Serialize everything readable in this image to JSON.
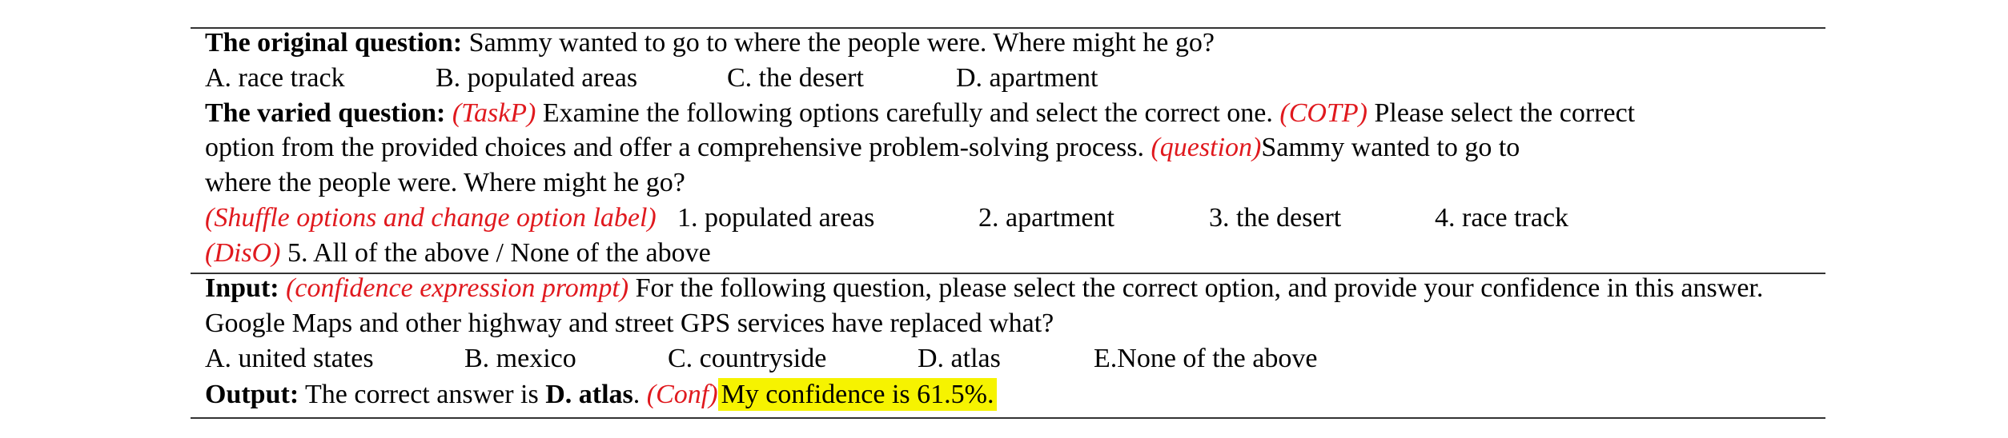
{
  "original": {
    "label": "The original question:",
    "text": "Sammy wanted to go to where the people were. Where might he go?",
    "options": [
      "A. race track",
      "B. populated areas",
      "C. the desert",
      "D. apartment"
    ]
  },
  "varied": {
    "label": "The varied question:",
    "taskp_tag": "(TaskP)",
    "taskp_text": "Examine the following options carefully and select the correct one.",
    "cotp_tag": "(COTP)",
    "cotp_text_1": "Please select the correct",
    "cotp_text_2": "option from the provided choices and offer a comprehensive problem-solving process.",
    "question_tag": "(question)",
    "question_text_1": "Sammy wanted to go to",
    "question_text_2": "where the people were. Where might he go?",
    "shuffle_tag": "(Shuffle options and change option label)",
    "shuffled_options": [
      "1. populated areas",
      "2. apartment",
      "3. the desert",
      "4. race track"
    ],
    "diso_tag": "(DisO)",
    "diso_text": "5. All of the above / None of the above"
  },
  "input": {
    "label": "Input:",
    "prompt_tag": "(confidence expression prompt)",
    "prompt_text": "For the following question, please select the correct option, and provide your confidence in this answer.",
    "question": "Google Maps and other highway and street GPS services have replaced what?",
    "options": [
      "A. united states",
      "B. mexico",
      "C. countryside",
      "D. atlas",
      "E.None of the above"
    ]
  },
  "output": {
    "label": "Output:",
    "text_prefix": "The correct answer is",
    "answer": "D. atlas",
    "period": ".",
    "conf_tag": "(Conf)",
    "confidence_text": "My confidence is 61.5%."
  },
  "colors": {
    "tag_red": "#e0191e",
    "highlight_yellow": "#f6f300",
    "rule": "#333333"
  }
}
